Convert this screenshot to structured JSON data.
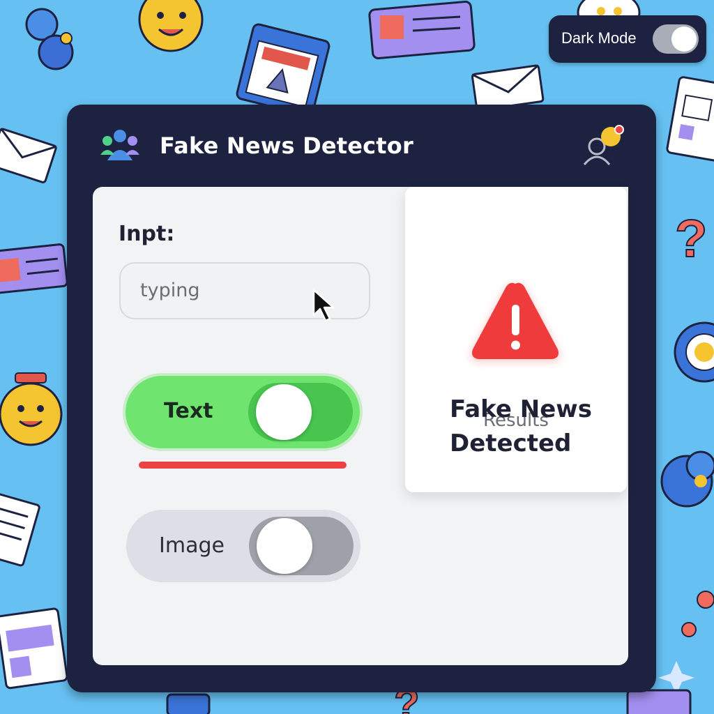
{
  "topbar": {
    "dark_mode_label": "Dark Mode",
    "dark_mode_on": true
  },
  "window": {
    "title": "Fake News Detector",
    "logo_icon": "people-group-icon",
    "profile_icon": "user-notification-icon"
  },
  "input": {
    "label": "Inpt:",
    "value": "typing"
  },
  "toggles": [
    {
      "label": "Text",
      "state": "on"
    },
    {
      "label": "Image",
      "state": "on"
    }
  ],
  "results": {
    "title": "Results",
    "icon": "warning-triangle-icon",
    "verdict": "Fake News Detected"
  },
  "colors": {
    "background": "#66c1f2",
    "window": "#1d2240",
    "accent_green": "#6fe56f",
    "alert_red": "#ec4242"
  }
}
